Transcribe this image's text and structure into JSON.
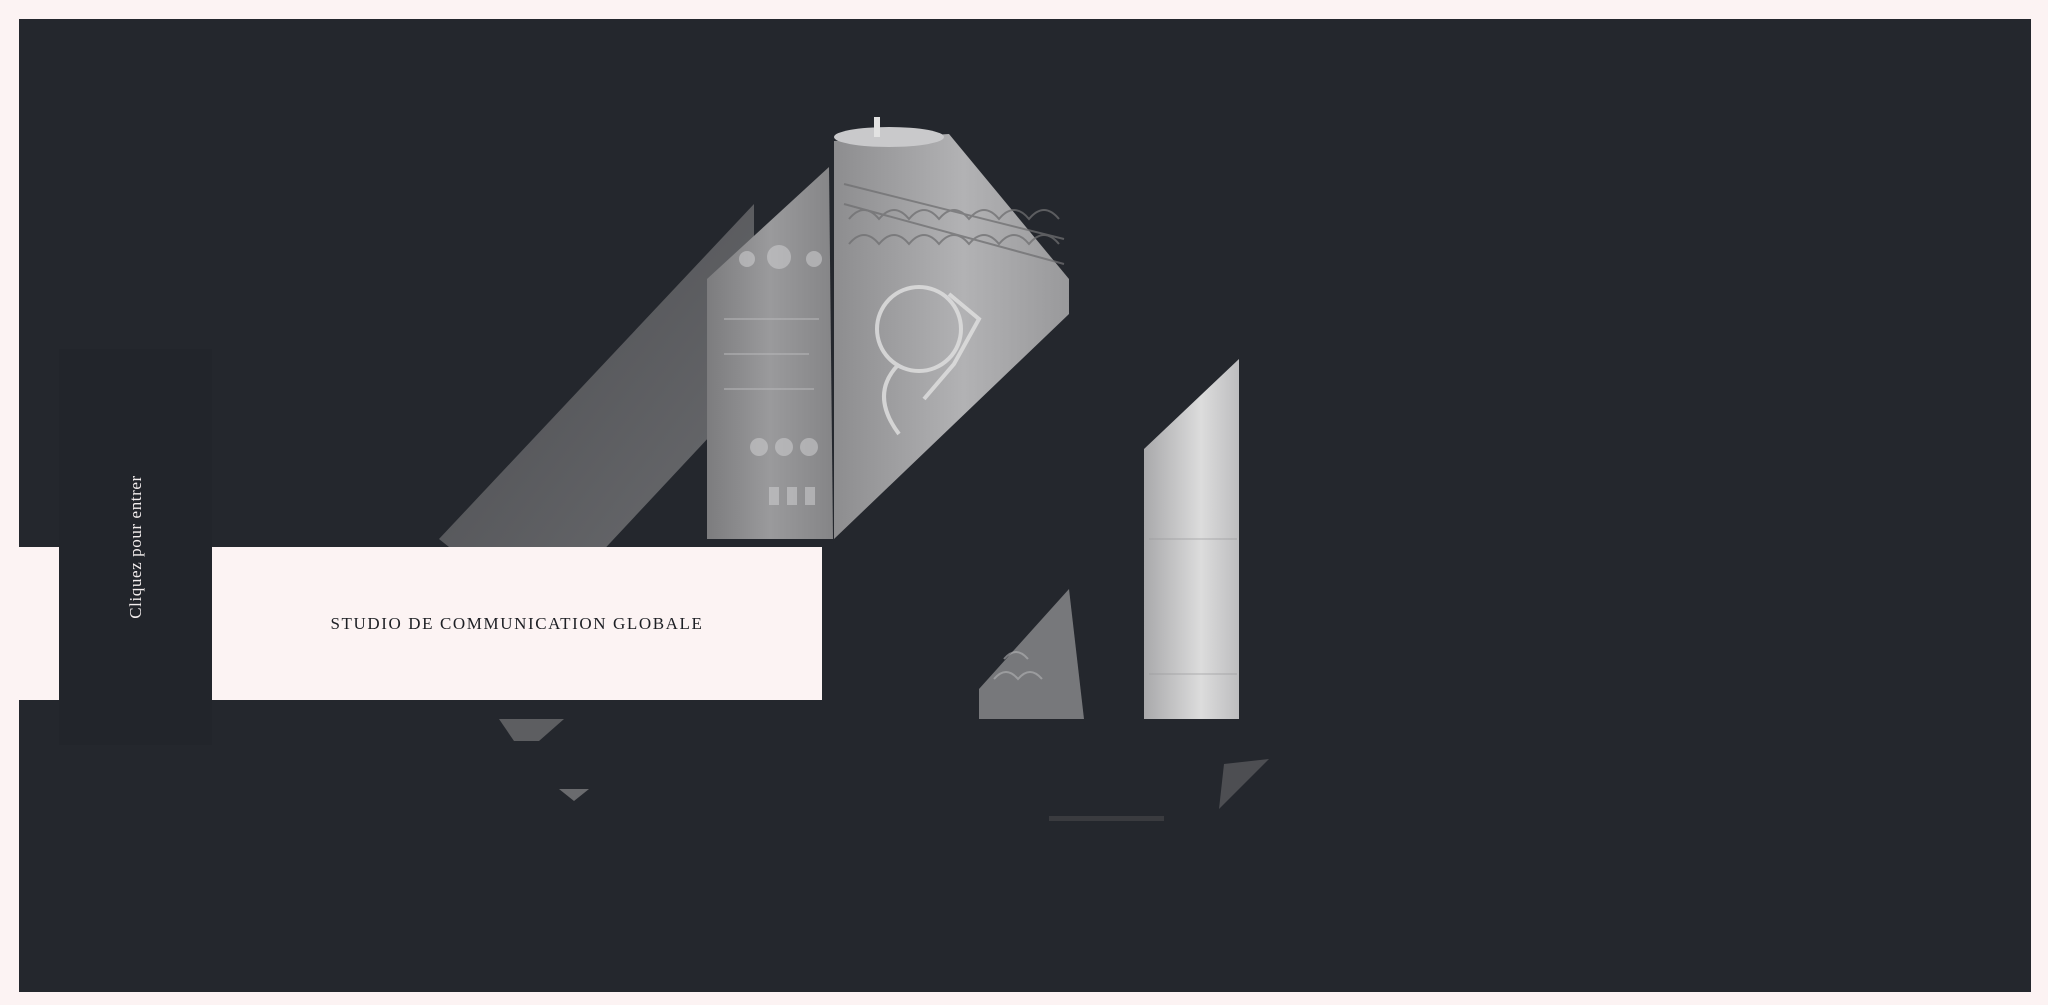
{
  "enter": {
    "label": "Cliquez pour entrer"
  },
  "tagline": {
    "text": "STUDIO DE COMMUNICATION GLOBALE"
  },
  "colors": {
    "background": "#24272d",
    "frame": "#fcf3f3",
    "text_light": "#f3eeee",
    "text_dark": "#1d1f24"
  }
}
